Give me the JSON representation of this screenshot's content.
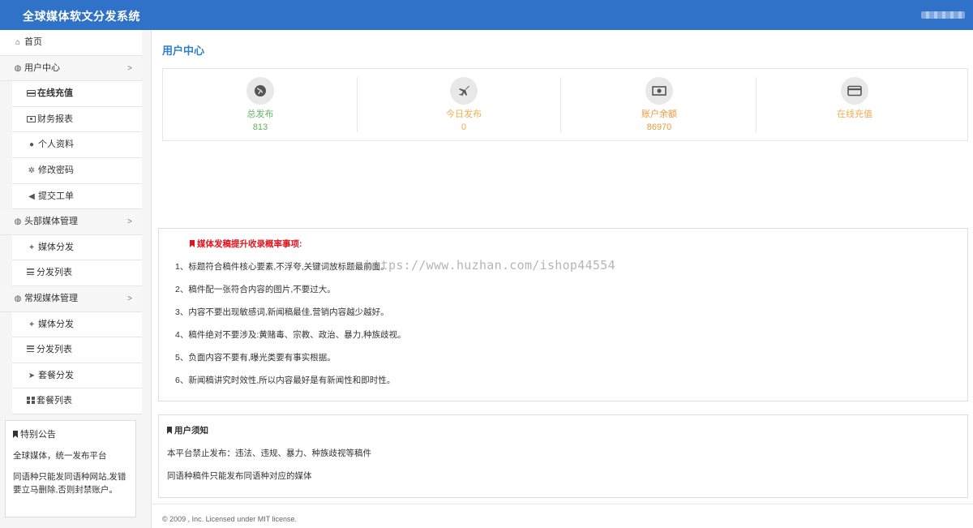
{
  "header": {
    "title": "全球媒体软文分发系统"
  },
  "sidebar": {
    "items": [
      {
        "label": "首页",
        "icon": "home-icon",
        "kind": "top"
      },
      {
        "label": "用户中心",
        "icon": "globe-icon",
        "kind": "group"
      },
      {
        "label": "在线充值",
        "icon": "credit-card-icon",
        "kind": "sub",
        "active": true
      },
      {
        "label": "财务报表",
        "icon": "money-icon",
        "kind": "sub"
      },
      {
        "label": "个人资料",
        "icon": "user-icon",
        "kind": "sub"
      },
      {
        "label": "修改密码",
        "icon": "gear-icon",
        "kind": "sub"
      },
      {
        "label": "提交工单",
        "icon": "volume-icon",
        "kind": "sub"
      },
      {
        "label": "头部媒体管理",
        "icon": "globe-icon",
        "kind": "group"
      },
      {
        "label": "媒体分发",
        "icon": "plus-icon",
        "kind": "sub"
      },
      {
        "label": "分发列表",
        "icon": "bars-icon",
        "kind": "sub"
      },
      {
        "label": "常规媒体管理",
        "icon": "globe-icon",
        "kind": "group"
      },
      {
        "label": "媒体分发",
        "icon": "plus-icon",
        "kind": "sub"
      },
      {
        "label": "分发列表",
        "icon": "bars-icon",
        "kind": "sub"
      },
      {
        "label": "套餐分发",
        "icon": "send-icon",
        "kind": "sub"
      },
      {
        "label": "套餐列表",
        "icon": "grid-icon",
        "kind": "sub"
      }
    ],
    "notice": {
      "title": "特别公告",
      "line1": "全球媒体，统一发布平台",
      "line2": "同语种只能发同语种网站,发错要立马删除,否则封禁账户。"
    }
  },
  "main": {
    "title": "用户中心",
    "stats": [
      {
        "label": "总发布",
        "value": "813",
        "icon": "globe-icon",
        "color": "#5cb85c"
      },
      {
        "label": "今日发布",
        "value": "0",
        "icon": "plane-icon",
        "color": "#f0ad4e"
      },
      {
        "label": "账户余额",
        "value": "86970",
        "icon": "money-icon",
        "color": "#e99a3c"
      },
      {
        "label": "在线充值",
        "value": "",
        "icon": "credit-card-icon",
        "color": "#f0ad4e"
      }
    ],
    "tips": {
      "title": "媒体发稿提升收录概率事项:",
      "items": [
        "1、标题符合稿件核心要素,不浮夸,关键词放标题最前面。",
        "2、稿件配一张符合内容的图片,不要过大。",
        "3、内容不要出现敏感词,新闻稿最佳,营销内容越少越好。",
        "4、稿件绝对不要涉及:黄赌毒、宗教、政治、暴力,种族歧视。",
        "5、负面内容不要有,曝光类要有事实根据。",
        "6、新闻稿讲究时效性,所以内容最好是有新闻性和即时性。"
      ],
      "watermark": "https://www.huzhan.com/ishop44554"
    },
    "notice": {
      "title": "用户须知",
      "line1": "本平台禁止发布：违法、违规、暴力、种族歧视等稿件",
      "line2": "同语种稿件只能发布同语种对应的媒体"
    },
    "footer": "© 2009 , Inc. Licensed under MIT license."
  },
  "colors": {
    "header": "#2f72c8",
    "title": "#2f80c8",
    "tipsTitle": "#e0141e"
  }
}
